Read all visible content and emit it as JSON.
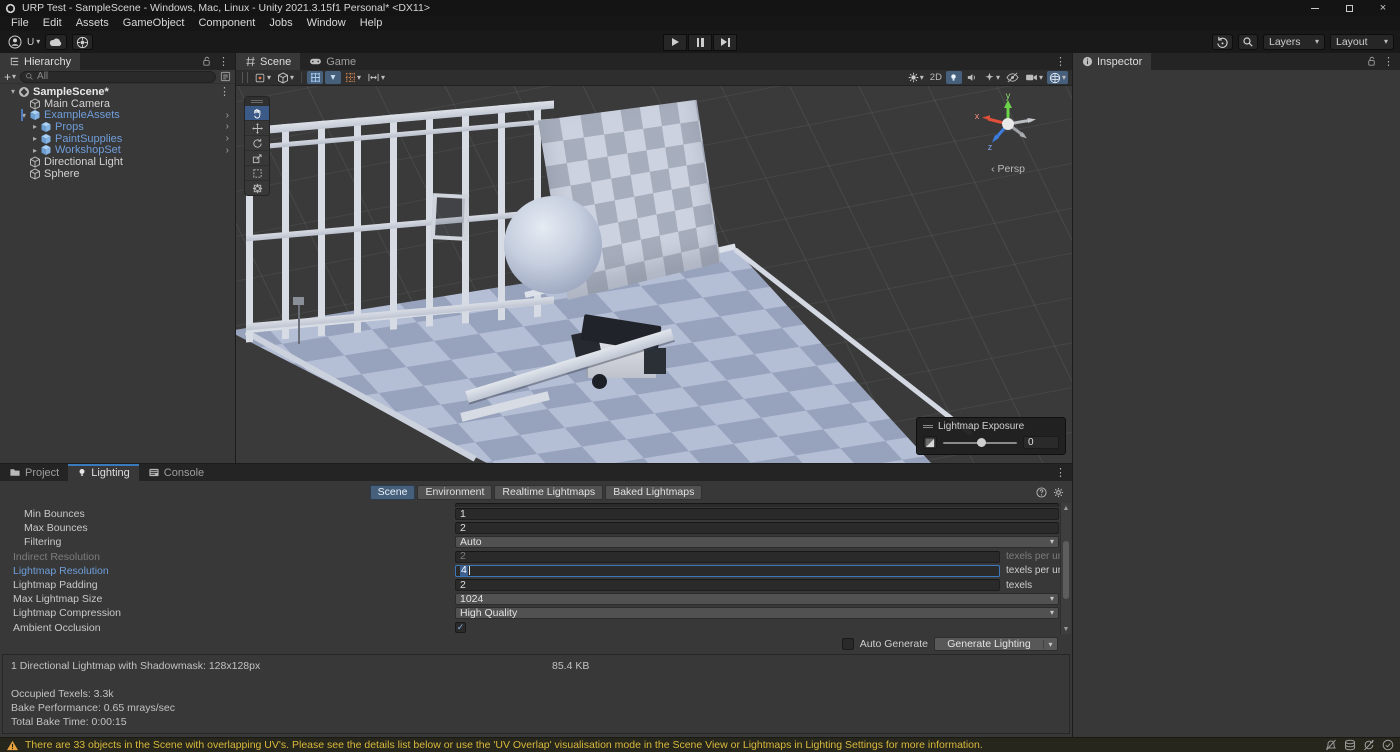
{
  "colors": {
    "accent_blue": "#3a79bb",
    "selection_blue": "#46607c",
    "prefab_blue": "#6f9edb",
    "warning_yellow": "#d9b93c",
    "panel_gray": "#383838"
  },
  "title_bar": {
    "title": "URP Test - SampleScene - Windows, Mac, Linux - Unity 2021.3.15f1 Personal* <DX11>",
    "window_buttons": [
      "minimize",
      "maximize",
      "close"
    ]
  },
  "menu_bar": {
    "items": [
      "File",
      "Edit",
      "Assets",
      "GameObject",
      "Component",
      "Jobs",
      "Window",
      "Help"
    ]
  },
  "toolbar": {
    "account_label": "U",
    "layers_label": "Layers",
    "layout_label": "Layout"
  },
  "hierarchy": {
    "tab": "Hierarchy",
    "search_placeholder": "All",
    "items": [
      {
        "label": "SampleScene*",
        "depth": 0,
        "icon": "unity-scene",
        "arrow": "open",
        "bold": true,
        "kebab": true
      },
      {
        "label": "Main Camera",
        "depth": 1,
        "icon": "gameobject"
      },
      {
        "label": "ExampleAssets",
        "depth": 1,
        "icon": "prefab",
        "arrow": "open",
        "prefab": true,
        "chevron": true,
        "selected_bar": true
      },
      {
        "label": "Props",
        "depth": 2,
        "icon": "prefab",
        "arrow": "closed",
        "prefab": true,
        "chevron": true
      },
      {
        "label": "PaintSupplies",
        "depth": 2,
        "icon": "prefab",
        "arrow": "closed",
        "prefab": true,
        "chevron": true
      },
      {
        "label": "WorkshopSet",
        "depth": 2,
        "icon": "prefab",
        "arrow": "closed",
        "prefab": true,
        "chevron": true
      },
      {
        "label": "Directional Light",
        "depth": 1,
        "icon": "gameobject"
      },
      {
        "label": "Sphere",
        "depth": 1,
        "icon": "gameobject"
      }
    ]
  },
  "scene_view": {
    "tabs": [
      "Scene",
      "Game"
    ],
    "active_tab": "Scene",
    "toolbar_2d_label": "2D",
    "axis_labels": {
      "x": "x",
      "y": "y",
      "z": "z"
    },
    "projection_label": "Persp",
    "overlay": {
      "title": "Lightmap Exposure",
      "value": "0"
    }
  },
  "inspector": {
    "tab": "Inspector"
  },
  "bottom_panel": {
    "tabs": [
      "Project",
      "Lighting",
      "Console"
    ],
    "active_tab": "Lighting",
    "lighting": {
      "tabs": [
        "Scene",
        "Environment",
        "Realtime Lightmaps",
        "Baked Lightmaps"
      ],
      "active_tab": "Scene",
      "rows": [
        {
          "label": "Min Bounces",
          "value": "1",
          "control": "field",
          "indent": 1
        },
        {
          "label": "Max Bounces",
          "value": "2",
          "control": "field",
          "indent": 1
        },
        {
          "label": "Filtering",
          "value": "Auto",
          "control": "dropdown",
          "indent": 1
        },
        {
          "label": "Indirect Resolution",
          "value": "2",
          "unit": "texels per unit",
          "control": "field",
          "disabled": true
        },
        {
          "label": "Lightmap Resolution",
          "value": "4",
          "unit": "texels per unit",
          "control": "field",
          "editing": true
        },
        {
          "label": "Lightmap Padding",
          "value": "2",
          "unit": "texels",
          "control": "field"
        },
        {
          "label": "Max Lightmap Size",
          "value": "1024",
          "control": "dropdown"
        },
        {
          "label": "Lightmap Compression",
          "value": "High Quality",
          "control": "dropdown"
        },
        {
          "label": "Ambient Occlusion",
          "value": "",
          "control": "checkbox",
          "checked": true
        }
      ],
      "auto_generate_label": "Auto Generate",
      "generate_button_label": "Generate Lighting",
      "stats": {
        "lightmap_info": "1 Directional Lightmap with Shadowmask: 128x128px",
        "size": "85.4 KB",
        "occupied_texels": "Occupied Texels: 3.3k",
        "bake_performance": "Bake Performance: 0.65 mrays/sec",
        "total_bake_time": "Total Bake Time: 0:00:15"
      }
    }
  },
  "status_bar": {
    "warning": "There are 33 objects in the Scene with overlapping UV's. Please see the details list below or use the 'UV Overlap' visualisation mode in the Scene View or Lightmaps in Lighting Settings for more information."
  },
  "icons": {
    "kebab": "⋮",
    "dropdown_arrow": "▾",
    "tree_open": "▾",
    "tree_closed": "▸",
    "prefab_chevron": "›",
    "scroll_up": "▲",
    "scroll_down": "▼",
    "check": "✓",
    "close": "×",
    "plus": "+"
  }
}
